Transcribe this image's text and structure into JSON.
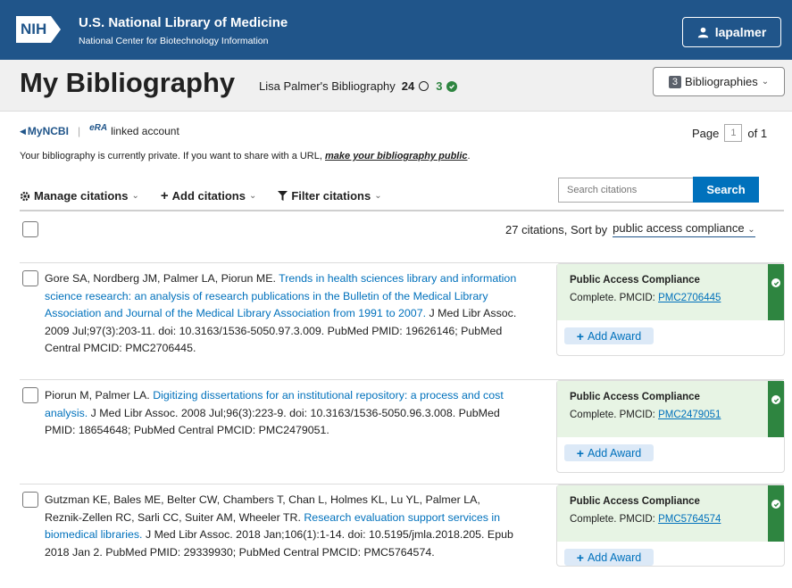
{
  "header": {
    "logo_text": "NIH",
    "org_title": "U.S. National Library of Medicine",
    "org_subtitle": "National Center for Biotechnology Information",
    "user": "lapalmer"
  },
  "band": {
    "title": "My Bibliography",
    "owner": "Lisa Palmer's Bibliography",
    "incomplete_count": "24",
    "complete_count": "3",
    "bib_count": "3",
    "bib_label": "Bibliographies"
  },
  "nav": {
    "myncbi": "MyNCBI",
    "era_label": "eRA",
    "linked": "linked account",
    "page_label": "Page",
    "page_current": "1",
    "page_total": "of 1"
  },
  "privacy": {
    "message": "Your bibliography is currently private. If you want to share with a URL,",
    "link": "make your bibliography public",
    "end": "."
  },
  "toolbar": {
    "manage": "Manage citations",
    "add": "Add citations",
    "filter": "Filter citations",
    "search_placeholder": "Search citations",
    "search_button": "Search"
  },
  "sort": {
    "count_text": "27 citations, Sort by",
    "value": "public access compliance"
  },
  "citations": [
    {
      "authors": "Gore SA, Nordberg JM, Palmer LA, Piorun ME.",
      "title": "Trends in health sciences library and information science research: an analysis of research publications in the Bulletin of the Medical Library Association and Journal of the Medical Library Association from 1991 to 2007.",
      "rest": "J Med Libr Assoc. 2009 Jul;97(3):203-11. doi: 10.3163/1536-5050.97.3.009. PubMed PMID: 19626146; PubMed Central PMCID: PMC2706445.",
      "pac_label": "Public Access Compliance",
      "pac_status": "Complete. PMCID:",
      "pmcid": "PMC2706445",
      "award": "Add Award"
    },
    {
      "authors": "Piorun M, Palmer LA.",
      "title": "Digitizing dissertations for an institutional repository: a process and cost analysis.",
      "rest": "J Med Libr Assoc. 2008 Jul;96(3):223-9. doi: 10.3163/1536-5050.96.3.008. PubMed PMID: 18654648; PubMed Central PMCID: PMC2479051.",
      "pac_label": "Public Access Compliance",
      "pac_status": "Complete. PMCID:",
      "pmcid": "PMC2479051",
      "award": "Add Award"
    },
    {
      "authors": "Gutzman KE, Bales ME, Belter CW, Chambers T, Chan L, Holmes KL, Lu YL, Palmer LA, Reznik-Zellen RC, Sarli CC, Suiter AM, Wheeler TR.",
      "title": "Research evaluation support services in biomedical libraries.",
      "rest": "J Med Libr Assoc. 2018 Jan;106(1):1-14. doi: 10.5195/jmla.2018.205. Epub 2018 Jan 2. PubMed PMID: 29339930; PubMed Central PMCID: PMC5764574.",
      "pac_label": "Public Access Compliance",
      "pac_status": "Complete. PMCID:",
      "pmcid": "PMC5764574",
      "award": "Add Award"
    }
  ],
  "colors": {
    "header_blue": "#20558a",
    "link_blue": "#0071bc",
    "compliance_green": "#2e8540",
    "compliance_bg": "#e7f4e4"
  }
}
